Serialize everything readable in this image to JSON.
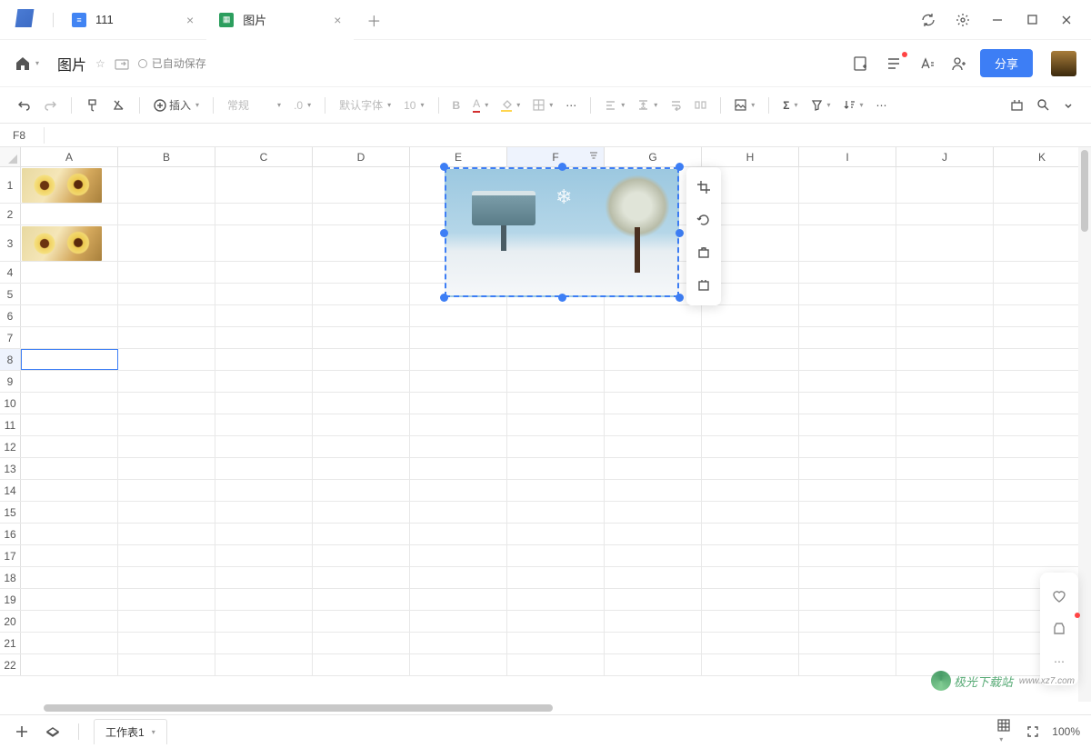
{
  "tabs": [
    {
      "title": "111",
      "type": "doc"
    },
    {
      "title": "图片",
      "type": "sheet",
      "active": true
    }
  ],
  "docTitle": "图片",
  "autosave": "已自动保存",
  "shareLabel": "分享",
  "toolbar": {
    "insert": "插入",
    "style": "常规",
    "decimal": ".0",
    "font": "默认字体",
    "fontSize": "10"
  },
  "nameBox": "F8",
  "columns": [
    "A",
    "B",
    "C",
    "D",
    "E",
    "F",
    "G",
    "H",
    "I",
    "J",
    "K"
  ],
  "rowCount": 22,
  "selectedCell": {
    "row": 8,
    "col": "A"
  },
  "activeColumn": "F",
  "sheetTab": "工作表1",
  "zoom": "100%",
  "watermark": "极光下载站",
  "watermarkUrl": "www.xz7.com",
  "imageTools": [
    "crop",
    "rotate",
    "replace",
    "reset"
  ]
}
